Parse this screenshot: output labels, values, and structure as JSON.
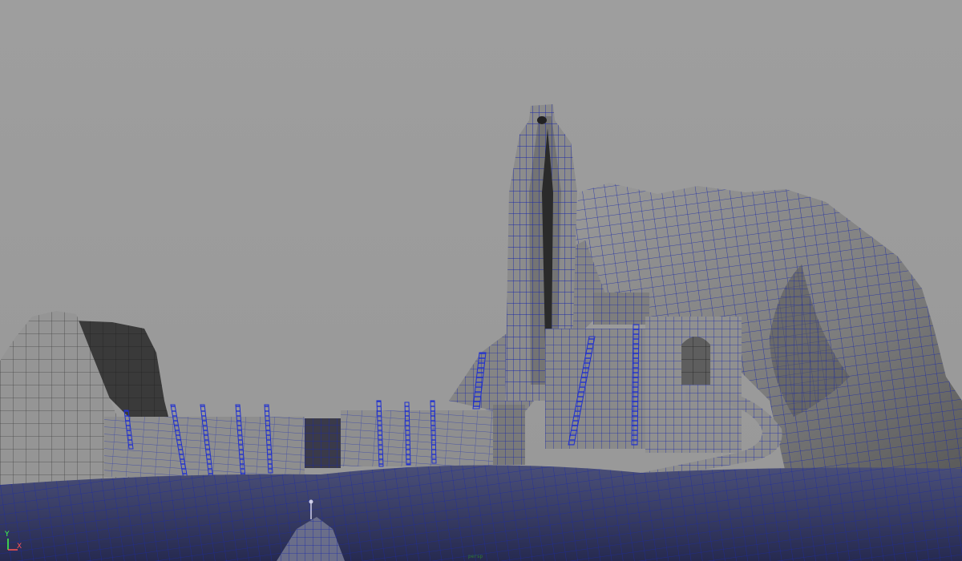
{
  "viewport": {
    "mode": "wireframe-on-shaded",
    "colors": {
      "background": "#9c9c9c",
      "wire": "#1c2aa8",
      "shade_light": "#8a8a8a",
      "shade_mid": "#6e6e6e",
      "shade_dark": "#3a3a3a",
      "ground": "#30355e"
    }
  },
  "axis_indicator": {
    "y_label": "Y",
    "x_label": "X",
    "icon": "axis-gizmo-icon"
  },
  "status": {
    "readout": "persp"
  }
}
